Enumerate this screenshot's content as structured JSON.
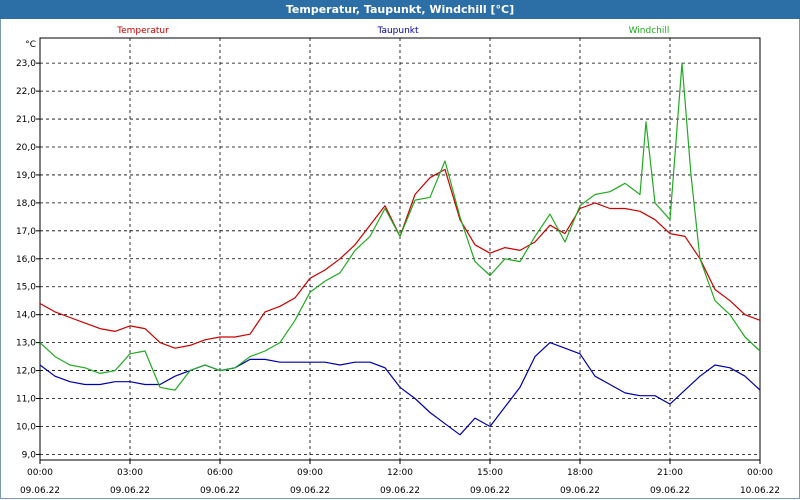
{
  "window": {
    "title": "Temperatur, Taupunkt, Windchill [°C]"
  },
  "chart_data": {
    "type": "line",
    "title": "Temperatur, Taupunkt, Windchill [°C]",
    "ylabel": "°C",
    "xlabel": "",
    "ylim": [
      8.8,
      23.9
    ],
    "yticks": [
      "9,0",
      "10,0",
      "11,0",
      "12,0",
      "13,0",
      "14,0",
      "15,0",
      "16,0",
      "17,0",
      "18,0",
      "19,0",
      "20,0",
      "21,0",
      "22,0",
      "23,0"
    ],
    "xticks": [
      {
        "time": "00:00",
        "date": "09.06.22"
      },
      {
        "time": "03:00",
        "date": "09.06.22"
      },
      {
        "time": "06:00",
        "date": "09.06.22"
      },
      {
        "time": "09:00",
        "date": "09.06.22"
      },
      {
        "time": "12:00",
        "date": "09.06.22"
      },
      {
        "time": "15:00",
        "date": "09.06.22"
      },
      {
        "time": "18:00",
        "date": "09.06.22"
      },
      {
        "time": "21:00",
        "date": "09.06.22"
      },
      {
        "time": "00:00",
        "date": "10.06.22"
      }
    ],
    "xlim_hours": [
      0,
      24
    ],
    "grid": true,
    "legend_placement": "top",
    "series": [
      {
        "name": "Temperatur",
        "color": "#cc0000",
        "x": [
          0,
          0.5,
          1,
          1.5,
          2,
          2.5,
          3,
          3.5,
          4,
          4.5,
          5,
          5.5,
          6,
          6.5,
          7,
          7.5,
          8,
          8.5,
          9,
          9.5,
          10,
          10.5,
          11,
          11.5,
          12,
          12.5,
          13,
          13.5,
          14,
          14.5,
          15,
          15.5,
          16,
          16.5,
          17,
          17.5,
          18,
          18.5,
          19,
          19.5,
          20,
          20.5,
          21,
          21.5,
          22,
          22.5,
          23,
          23.5,
          24
        ],
        "y": [
          14.4,
          14.1,
          13.9,
          13.7,
          13.5,
          13.4,
          13.6,
          13.5,
          13.0,
          12.8,
          12.9,
          13.1,
          13.2,
          13.2,
          13.3,
          14.1,
          14.3,
          14.6,
          15.3,
          15.6,
          16.0,
          16.5,
          17.2,
          17.9,
          16.8,
          18.3,
          18.9,
          19.2,
          17.4,
          16.5,
          16.2,
          16.4,
          16.3,
          16.6,
          17.2,
          16.9,
          17.8,
          18.0,
          17.8,
          17.8,
          17.7,
          17.4,
          16.9,
          16.8,
          16.0,
          14.9,
          14.5,
          14.0,
          13.8
        ]
      },
      {
        "name": "Taupunkt",
        "color": "#0000aa",
        "x": [
          0,
          0.5,
          1,
          1.5,
          2,
          2.5,
          3,
          3.5,
          4,
          4.5,
          5,
          5.5,
          6,
          6.5,
          7,
          7.5,
          8,
          8.5,
          9,
          9.5,
          10,
          10.5,
          11,
          11.5,
          12,
          12.5,
          13,
          13.5,
          14,
          14.5,
          15,
          15.5,
          16,
          16.5,
          17,
          17.5,
          18,
          18.5,
          19,
          19.5,
          20,
          20.5,
          21,
          21.5,
          22,
          22.5,
          23,
          23.5,
          24
        ],
        "y": [
          12.2,
          11.8,
          11.6,
          11.5,
          11.5,
          11.6,
          11.6,
          11.5,
          11.5,
          11.8,
          12.0,
          12.2,
          12.0,
          12.1,
          12.4,
          12.4,
          12.3,
          12.3,
          12.3,
          12.3,
          12.2,
          12.3,
          12.3,
          12.1,
          11.4,
          11.0,
          10.5,
          10.1,
          9.7,
          10.3,
          10.0,
          10.7,
          11.4,
          12.5,
          13.0,
          12.8,
          12.6,
          11.8,
          11.5,
          11.2,
          11.1,
          11.1,
          10.8,
          11.3,
          11.8,
          12.2,
          12.1,
          11.8,
          11.3
        ]
      },
      {
        "name": "Windchill",
        "color": "#22aa22",
        "x": [
          0,
          0.5,
          1,
          1.5,
          2,
          2.5,
          3,
          3.5,
          4,
          4.5,
          5,
          5.5,
          6,
          6.5,
          7,
          7.5,
          8,
          8.5,
          9,
          9.5,
          10,
          10.5,
          11,
          11.5,
          12,
          12.5,
          13,
          13.5,
          14,
          14.5,
          15,
          15.5,
          16,
          16.5,
          17,
          17.5,
          18,
          18.5,
          19,
          19.5,
          20,
          20.2,
          20.5,
          21,
          21.4,
          21.7,
          22,
          22.5,
          23,
          23.5,
          24
        ],
        "y": [
          13.0,
          12.5,
          12.2,
          12.1,
          11.9,
          12.0,
          12.6,
          12.7,
          11.4,
          11.3,
          12.0,
          12.2,
          12.0,
          12.1,
          12.5,
          12.7,
          13.0,
          13.8,
          14.8,
          15.2,
          15.5,
          16.3,
          16.8,
          17.8,
          16.8,
          18.1,
          18.2,
          19.5,
          17.5,
          15.9,
          15.4,
          16.0,
          15.9,
          16.8,
          17.6,
          16.6,
          17.9,
          18.3,
          18.4,
          18.7,
          18.3,
          20.9,
          18.0,
          17.4,
          23.0,
          19.0,
          16.0,
          14.5,
          14.0,
          13.2,
          12.7
        ]
      }
    ]
  }
}
